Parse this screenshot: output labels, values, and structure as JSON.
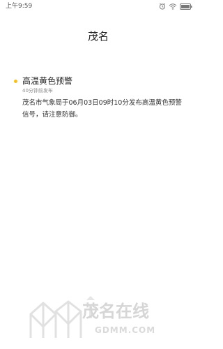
{
  "status_bar": {
    "time": "上午9:59",
    "icons": [
      "alarm-icon",
      "wifi-icon",
      "battery-icon"
    ]
  },
  "page": {
    "title": "茂名"
  },
  "warning": {
    "title": "高温黄色预警",
    "time": "40分钟前发布",
    "body": "茂名市气象局于06月03日09时10分发布高温黄色预警信号，请注意防御。",
    "dot_color": "#f4c11f"
  },
  "watermark": {
    "text": "茂名在线",
    "sub": "GDMM.COM"
  }
}
